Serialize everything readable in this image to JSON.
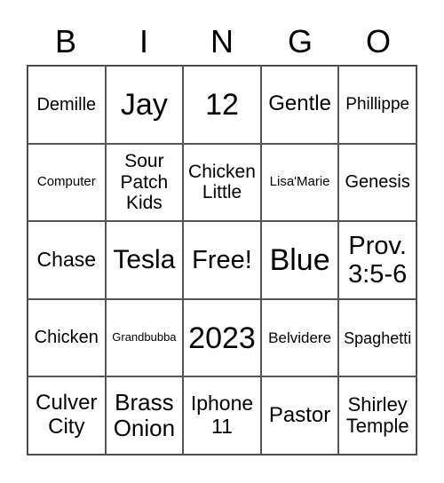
{
  "header": [
    "B",
    "I",
    "N",
    "G",
    "O"
  ],
  "cells": [
    [
      "Demille",
      "Jay",
      "12",
      "Gentle",
      "Phillippe"
    ],
    [
      "Computer",
      "Sour Patch Kids",
      "Chicken Little",
      "Lisa'Marie",
      "Genesis"
    ],
    [
      "Chase",
      "Tesla",
      "Free!",
      "Blue",
      "Prov. 3:5-6"
    ],
    [
      "Chicken",
      "Grandbubba",
      "2023",
      "Belvidere",
      "Spaghetti"
    ],
    [
      "Culver City",
      "Brass Onion",
      "Iphone 11",
      "Pastor",
      "Shirley Temple"
    ]
  ]
}
